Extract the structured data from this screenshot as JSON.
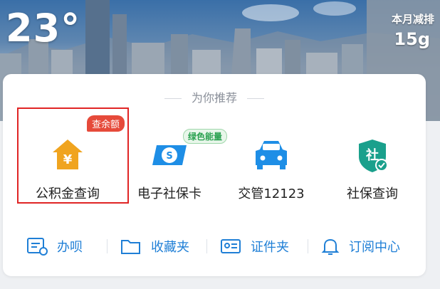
{
  "weather": {
    "temperature": "23°"
  },
  "emission": {
    "label": "本月减排",
    "value": "15g"
  },
  "recommend": {
    "title": "为你推荐",
    "items": [
      {
        "label": "公积金查询",
        "icon": "housing-fund-icon",
        "badge": "查余额"
      },
      {
        "label": "电子社保卡",
        "icon": "social-security-card-icon",
        "badge": "绿色能量"
      },
      {
        "label": "交管12123",
        "icon": "car-icon"
      },
      {
        "label": "社保查询",
        "icon": "shield-icon"
      }
    ]
  },
  "bottom": {
    "items": [
      {
        "label": "办呗",
        "icon": "calendar-icon"
      },
      {
        "label": "收藏夹",
        "icon": "folder-icon"
      },
      {
        "label": "证件夹",
        "icon": "id-card-icon"
      },
      {
        "label": "订阅中心",
        "icon": "bell-icon"
      }
    ]
  },
  "colors": {
    "accent": "#1f7fd6",
    "fund_icon": "#f0a41f",
    "badge_red": "#e64a3a",
    "highlight": "#e02525"
  }
}
